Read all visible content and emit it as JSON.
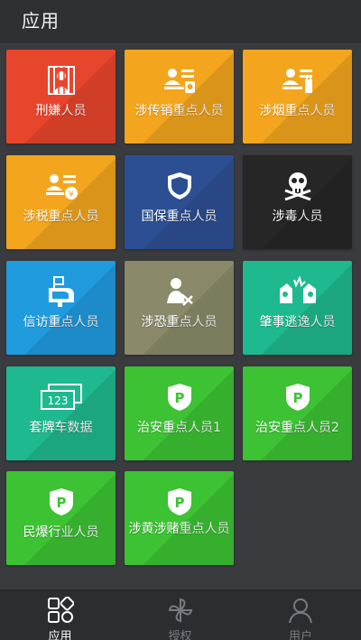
{
  "header": {
    "title": "应用"
  },
  "tiles": [
    {
      "label": "刑嫌人员",
      "icon": "prison-person-icon",
      "color": "#e8452d"
    },
    {
      "label": "涉传销重点人员",
      "icon": "id-card-person-icon",
      "color": "#f2a51d"
    },
    {
      "label": "涉烟重点人员",
      "icon": "id-card-cigarette-icon",
      "color": "#f2a51d"
    },
    {
      "label": "涉税重点人员",
      "icon": "id-card-money-icon",
      "color": "#f2a51d"
    },
    {
      "label": "国保重点人员",
      "icon": "shield-icon",
      "color": "#2c4f93"
    },
    {
      "label": "涉毒人员",
      "icon": "skull-crossbones-icon",
      "color": "#262626"
    },
    {
      "label": "信访重点人员",
      "icon": "mailbox-icon",
      "color": "#1f9bde"
    },
    {
      "label": "涉恐重点人员",
      "icon": "terror-person-icon",
      "color": "#8a8a6a"
    },
    {
      "label": "肇事逃逸人员",
      "icon": "car-crash-icon",
      "color": "#1fb98f"
    },
    {
      "label": "套牌车数据",
      "icon": "license-plate-icon",
      "color": "#1fb98f"
    },
    {
      "label": "治安重点人员1",
      "icon": "police-badge-icon",
      "color": "#3cc233"
    },
    {
      "label": "治安重点人员2",
      "icon": "police-badge-icon",
      "color": "#3cc233"
    },
    {
      "label": "民爆行业人员",
      "icon": "police-badge-icon",
      "color": "#3cc233"
    },
    {
      "label": "涉黄涉赌重点人员",
      "icon": "police-badge-icon",
      "color": "#3cc233"
    }
  ],
  "bottom_nav": [
    {
      "label": "应用",
      "icon": "apps-grid-icon",
      "active": true
    },
    {
      "label": "授权",
      "icon": "pinwheel-icon",
      "active": false
    },
    {
      "label": "用户",
      "icon": "user-icon",
      "active": false
    }
  ],
  "colors": {
    "background": "#3a3b3f",
    "header_bg": "#2f3034",
    "nav_bg": "#2c2d31",
    "nav_active": "#ffffff",
    "nav_inactive": "#7a7b80"
  }
}
